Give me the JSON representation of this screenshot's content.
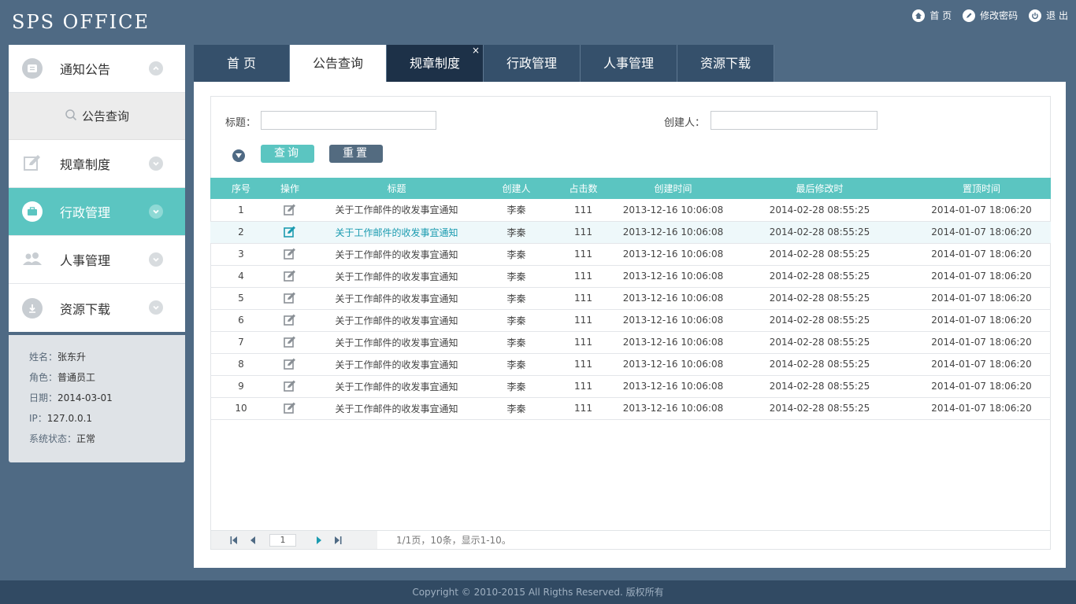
{
  "app": {
    "logo": "SPS OFFICE"
  },
  "top_links": [
    {
      "label": "首 页",
      "icon": "home-icon"
    },
    {
      "label": "修改密码",
      "icon": "edit-password-icon"
    },
    {
      "label": "退 出",
      "icon": "power-icon"
    }
  ],
  "sidebar": {
    "items": [
      {
        "label": "通知公告",
        "icon": "notice-icon",
        "expanded": true
      },
      {
        "label": "规章制度",
        "icon": "edit-icon"
      },
      {
        "label": "行政管理",
        "icon": "briefcase-icon",
        "active": true
      },
      {
        "label": "人事管理",
        "icon": "people-icon"
      },
      {
        "label": "资源下载",
        "icon": "download-icon"
      }
    ],
    "sub_item": {
      "label": "公告查询",
      "icon": "search-icon"
    }
  },
  "user_info": {
    "name_label": "姓名：",
    "name": "张东升",
    "role_label": "角色：",
    "role": "普通员工",
    "date_label": "日期：",
    "date": "2014-03-01",
    "ip_label": "IP：",
    "ip": "127.0.0.1",
    "status_label": "系统状态：",
    "status": "正常"
  },
  "tabs": [
    {
      "label": "首 页"
    },
    {
      "label": "公告查询",
      "active": true
    },
    {
      "label": "规章制度",
      "closable": true,
      "close": "×"
    },
    {
      "label": "行政管理"
    },
    {
      "label": "人事管理"
    },
    {
      "label": "资源下载"
    }
  ],
  "search": {
    "title_label": "标题：",
    "title_value": "",
    "creator_label": "创建人：",
    "creator_value": "",
    "query_button": "查询",
    "reset_button": "重置"
  },
  "table": {
    "columns": [
      "序号",
      "操作",
      "标题",
      "创建人",
      "占击数",
      "创建时间",
      "最后修改时",
      "置顶时间"
    ],
    "rows": [
      [
        "1",
        "关于工作邮件的收发事宜通知",
        "李秦",
        "111",
        "2013-12-16  10:06:08",
        "2014-02-28  08:55:25",
        "2014-01-07  18:06:20"
      ],
      [
        "2",
        "关于工作邮件的收发事宜通知",
        "李秦",
        "111",
        "2013-12-16  10:06:08",
        "2014-02-28  08:55:25",
        "2014-01-07  18:06:20"
      ],
      [
        "3",
        "关于工作邮件的收发事宜通知",
        "李秦",
        "111",
        "2013-12-16  10:06:08",
        "2014-02-28  08:55:25",
        "2014-01-07  18:06:20"
      ],
      [
        "4",
        "关于工作邮件的收发事宜通知",
        "李秦",
        "111",
        "2013-12-16  10:06:08",
        "2014-02-28  08:55:25",
        "2014-01-07  18:06:20"
      ],
      [
        "5",
        "关于工作邮件的收发事宜通知",
        "李秦",
        "111",
        "2013-12-16  10:06:08",
        "2014-02-28  08:55:25",
        "2014-01-07  18:06:20"
      ],
      [
        "6",
        "关于工作邮件的收发事宜通知",
        "李秦",
        "111",
        "2013-12-16  10:06:08",
        "2014-02-28  08:55:25",
        "2014-01-07  18:06:20"
      ],
      [
        "7",
        "关于工作邮件的收发事宜通知",
        "李秦",
        "111",
        "2013-12-16  10:06:08",
        "2014-02-28  08:55:25",
        "2014-01-07  18:06:20"
      ],
      [
        "8",
        "关于工作邮件的收发事宜通知",
        "李秦",
        "111",
        "2013-12-16  10:06:08",
        "2014-02-28  08:55:25",
        "2014-01-07  18:06:20"
      ],
      [
        "9",
        "关于工作邮件的收发事宜通知",
        "李秦",
        "111",
        "2013-12-16  10:06:08",
        "2014-02-28  08:55:25",
        "2014-01-07  18:06:20"
      ],
      [
        "10",
        "关于工作邮件的收发事宜通知",
        "李秦",
        "111",
        "2013-12-16  10:06:08",
        "2014-02-28  08:55:25",
        "2014-01-07  18:06:20"
      ]
    ],
    "highlight_row": 2
  },
  "pager": {
    "current_page": "1",
    "info": "1/1页，10条，显示1-10。"
  },
  "footer": {
    "copyright": "Copyright © 2010-2015 All Rigths Reserved. 版权所有"
  },
  "colors": {
    "accent": "#5bc5c1",
    "background": "#4f6a84",
    "tab_bg": "#35506b",
    "footer": "#314a63"
  }
}
